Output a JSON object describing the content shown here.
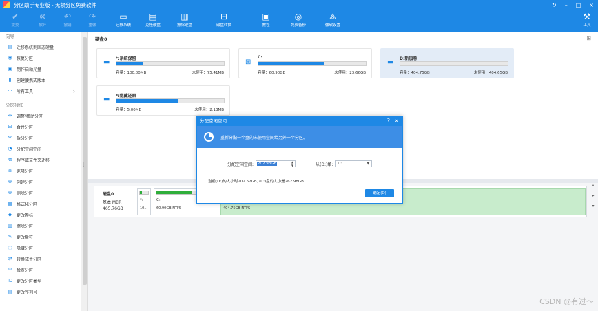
{
  "title_bar": {
    "title": "分区助手专业版 - 无损分区免费软件",
    "controls": [
      "↻",
      "–",
      "□",
      "×"
    ]
  },
  "toolbar": {
    "submit": "提交",
    "discard": "放弃",
    "undo": "撤销",
    "redo": "重做",
    "migrate_os": "迁移系统",
    "clone_disk": "克隆硬盘",
    "wipe_disk": "擦除硬盘",
    "disk_convert": "磁盘转换",
    "tutorial": "教程",
    "free_backup": "免费备份",
    "microsoft_setup": "微软设置",
    "tools": "工具"
  },
  "sidebar": {
    "wizard_title": "向导",
    "wizard_items": [
      {
        "icon": "migrate-icon",
        "glyph": "▤",
        "label": "迁移系统到固态硬盘"
      },
      {
        "icon": "recover-icon",
        "glyph": "◉",
        "label": "恢复分区"
      },
      {
        "icon": "bootdisk-icon",
        "glyph": "▣",
        "label": "制作启动光盘"
      },
      {
        "icon": "portable-icon",
        "glyph": "▮",
        "label": "创建便携式版本"
      },
      {
        "icon": "more-icon",
        "glyph": "···",
        "label": "所有工具"
      }
    ],
    "ops_title": "分区操作",
    "ops_items": [
      {
        "icon": "resize-icon",
        "glyph": "⇔",
        "label": "调整/移动分区"
      },
      {
        "icon": "merge-icon",
        "glyph": "⊞",
        "label": "合并分区"
      },
      {
        "icon": "split-icon",
        "glyph": "✂",
        "label": "拆分分区"
      },
      {
        "icon": "allocate-icon",
        "glyph": "◔",
        "label": "分配空闲空间"
      },
      {
        "icon": "appmove-icon",
        "glyph": "⧉",
        "label": "程序或文件夹迁移"
      },
      {
        "icon": "clone-icon",
        "glyph": "⧈",
        "label": "克隆分区"
      },
      {
        "icon": "create-icon",
        "glyph": "⊕",
        "label": "创建分区"
      },
      {
        "icon": "delete-icon",
        "glyph": "⊖",
        "label": "删除分区"
      },
      {
        "icon": "format-icon",
        "glyph": "▦",
        "label": "格式化分区"
      },
      {
        "icon": "label-icon",
        "glyph": "◆",
        "label": "更改卷标"
      },
      {
        "icon": "wipe-icon",
        "glyph": "▥",
        "label": "擦除分区"
      },
      {
        "icon": "letter-icon",
        "glyph": "✎",
        "label": "更改盘符"
      },
      {
        "icon": "hide-icon",
        "glyph": "◌",
        "label": "隐藏分区"
      },
      {
        "icon": "convert-icon",
        "glyph": "⇄",
        "label": "转换成主分区"
      },
      {
        "icon": "check-icon",
        "glyph": "⚲",
        "label": "检查分区"
      },
      {
        "icon": "type-icon",
        "glyph": "ID",
        "label": "更改分区类型"
      },
      {
        "icon": "serial-icon",
        "glyph": "▤",
        "label": "更改序列号"
      }
    ]
  },
  "main": {
    "disk_header": "硬盘0",
    "partitions": [
      {
        "name": "*:系统保留",
        "used_pct": 25,
        "capacity": "容量：100.00MB",
        "free": "未使用：75.41MB",
        "selected": false,
        "icon": "drive-icon",
        "glyph": "▬"
      },
      {
        "name": "C:",
        "used_pct": 61,
        "capacity": "容量：60.90GB",
        "free": "未使用：23.66GB",
        "selected": false,
        "icon": "windows-icon",
        "glyph": "⊞"
      },
      {
        "name": "D:新加卷",
        "used_pct": 0,
        "capacity": "容量：404.75GB",
        "free": "未使用：404.65GB",
        "selected": true,
        "icon": "drive-icon",
        "glyph": "▬"
      },
      {
        "name": "*:隐藏还原",
        "used_pct": 57,
        "capacity": "容量：5.00MB",
        "free": "未使用：2.13MB",
        "selected": false,
        "icon": "drive-icon",
        "glyph": "▬"
      }
    ],
    "disk_map": {
      "name": "硬盘0",
      "type": "基本 MBR",
      "size": "465.76GB",
      "parts": [
        {
          "name": "*:",
          "size": "10...",
          "used_pct": 25
        },
        {
          "name": "C:",
          "size": "60.90GB NTFS",
          "used_pct": 61
        },
        {
          "name": "",
          "size": "404.75GB NTFS",
          "used_pct": 0
        }
      ]
    }
  },
  "dialog": {
    "title": "分配空闲空间",
    "banner": "重新分配一个盘的未使用空间给另外一个分区。",
    "alloc_label": "分配空闲空间:",
    "alloc_value": "202.98GB",
    "from_label": "从(D:)给:",
    "target_value": "C:",
    "note": "当前(D:)的大小时202.67GB, (C:)盘的大小是262.98GB.",
    "ok": "确定(O)"
  },
  "watermark": "CSDN @有过～",
  "colors": {
    "accent": "#1e88e5",
    "green": "#2fae3b",
    "selected_card": "#e3ecf7"
  }
}
